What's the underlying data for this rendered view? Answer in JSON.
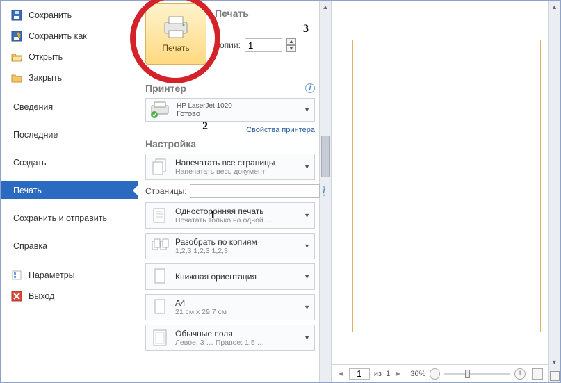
{
  "sidebar": {
    "save": "Сохранить",
    "save_as": "Сохранить как",
    "open": "Открыть",
    "close": "Закрыть",
    "info": "Сведения",
    "recent": "Последние",
    "new": "Создать",
    "print": "Печать",
    "save_send": "Сохранить и отправить",
    "help": "Справка",
    "options": "Параметры",
    "exit": "Выход"
  },
  "print": {
    "heading": "Печать",
    "button_label": "Печать",
    "copies_label": "Копии:",
    "copies_value": "1"
  },
  "printer": {
    "heading": "Принтер",
    "name": "HP LaserJet 1020",
    "status": "Готово",
    "properties_link": "Свойства принтера"
  },
  "settings": {
    "heading": "Настройка",
    "pages_label": "Страницы:",
    "pages_value": "",
    "opt_all_t": "Напечатать все страницы",
    "opt_all_s": "Напечатать весь документ",
    "opt_side_t": "Односторонняя печать",
    "opt_side_s": "Печатать только на одной …",
    "opt_collate_t": "Разобрать по копиям",
    "opt_collate_s": "1,2,3   1,2,3   1,2,3",
    "opt_orient_t": "Книжная ориентация",
    "opt_size_t": "A4",
    "opt_size_s": "21 см x 29,7 см",
    "opt_margin_t": "Обычные поля",
    "opt_margin_s": "Левое: 3 …   Правое: 1,5 …"
  },
  "annotations": {
    "a1": "1",
    "a2": "2",
    "a3": "3"
  },
  "preview": {
    "nav_label": "из",
    "page_current": "1",
    "page_total": "1",
    "zoom": "36%"
  }
}
